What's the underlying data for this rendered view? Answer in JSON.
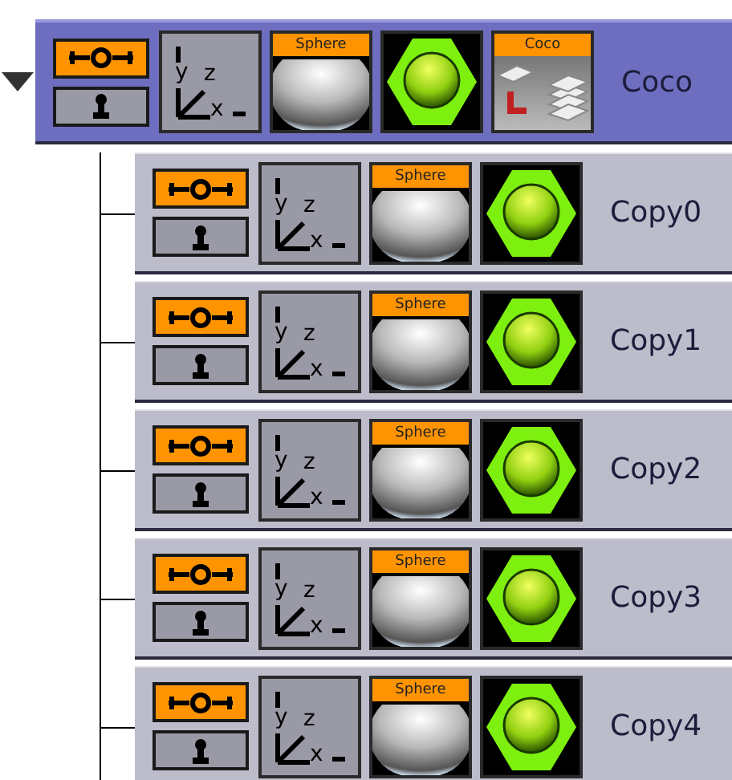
{
  "root": {
    "label": "Coco",
    "expanded": true,
    "toggles": [
      {
        "kind": "link",
        "on": true
      },
      {
        "kind": "person",
        "on": false
      }
    ],
    "tiles": [
      {
        "kind": "axes",
        "labels": [
          "y",
          "z",
          "x"
        ]
      },
      {
        "kind": "geometry",
        "tag": "Sphere"
      },
      {
        "kind": "material"
      },
      {
        "kind": "texture",
        "tag": "Coco"
      }
    ],
    "children": [
      {
        "label": "Copy0",
        "toggles": [
          {
            "kind": "link",
            "on": true
          },
          {
            "kind": "person",
            "on": false
          }
        ],
        "tiles": [
          {
            "kind": "axes",
            "labels": [
              "y",
              "z",
              "x"
            ]
          },
          {
            "kind": "geometry",
            "tag": "Sphere"
          },
          {
            "kind": "material"
          }
        ]
      },
      {
        "label": "Copy1",
        "toggles": [
          {
            "kind": "link",
            "on": true
          },
          {
            "kind": "person",
            "on": false
          }
        ],
        "tiles": [
          {
            "kind": "axes",
            "labels": [
              "y",
              "z",
              "x"
            ]
          },
          {
            "kind": "geometry",
            "tag": "Sphere"
          },
          {
            "kind": "material"
          }
        ]
      },
      {
        "label": "Copy2",
        "toggles": [
          {
            "kind": "link",
            "on": true
          },
          {
            "kind": "person",
            "on": false
          }
        ],
        "tiles": [
          {
            "kind": "axes",
            "labels": [
              "y",
              "z",
              "x"
            ]
          },
          {
            "kind": "geometry",
            "tag": "Sphere"
          },
          {
            "kind": "material"
          }
        ]
      },
      {
        "label": "Copy3",
        "toggles": [
          {
            "kind": "link",
            "on": true
          },
          {
            "kind": "person",
            "on": false
          }
        ],
        "tiles": [
          {
            "kind": "axes",
            "labels": [
              "y",
              "z",
              "x"
            ]
          },
          {
            "kind": "geometry",
            "tag": "Sphere"
          },
          {
            "kind": "material"
          }
        ]
      },
      {
        "label": "Copy4",
        "toggles": [
          {
            "kind": "link",
            "on": true
          },
          {
            "kind": "person",
            "on": false
          }
        ],
        "tiles": [
          {
            "kind": "axes",
            "labels": [
              "y",
              "z",
              "x"
            ]
          },
          {
            "kind": "geometry",
            "tag": "Sphere"
          },
          {
            "kind": "material"
          }
        ]
      }
    ]
  }
}
